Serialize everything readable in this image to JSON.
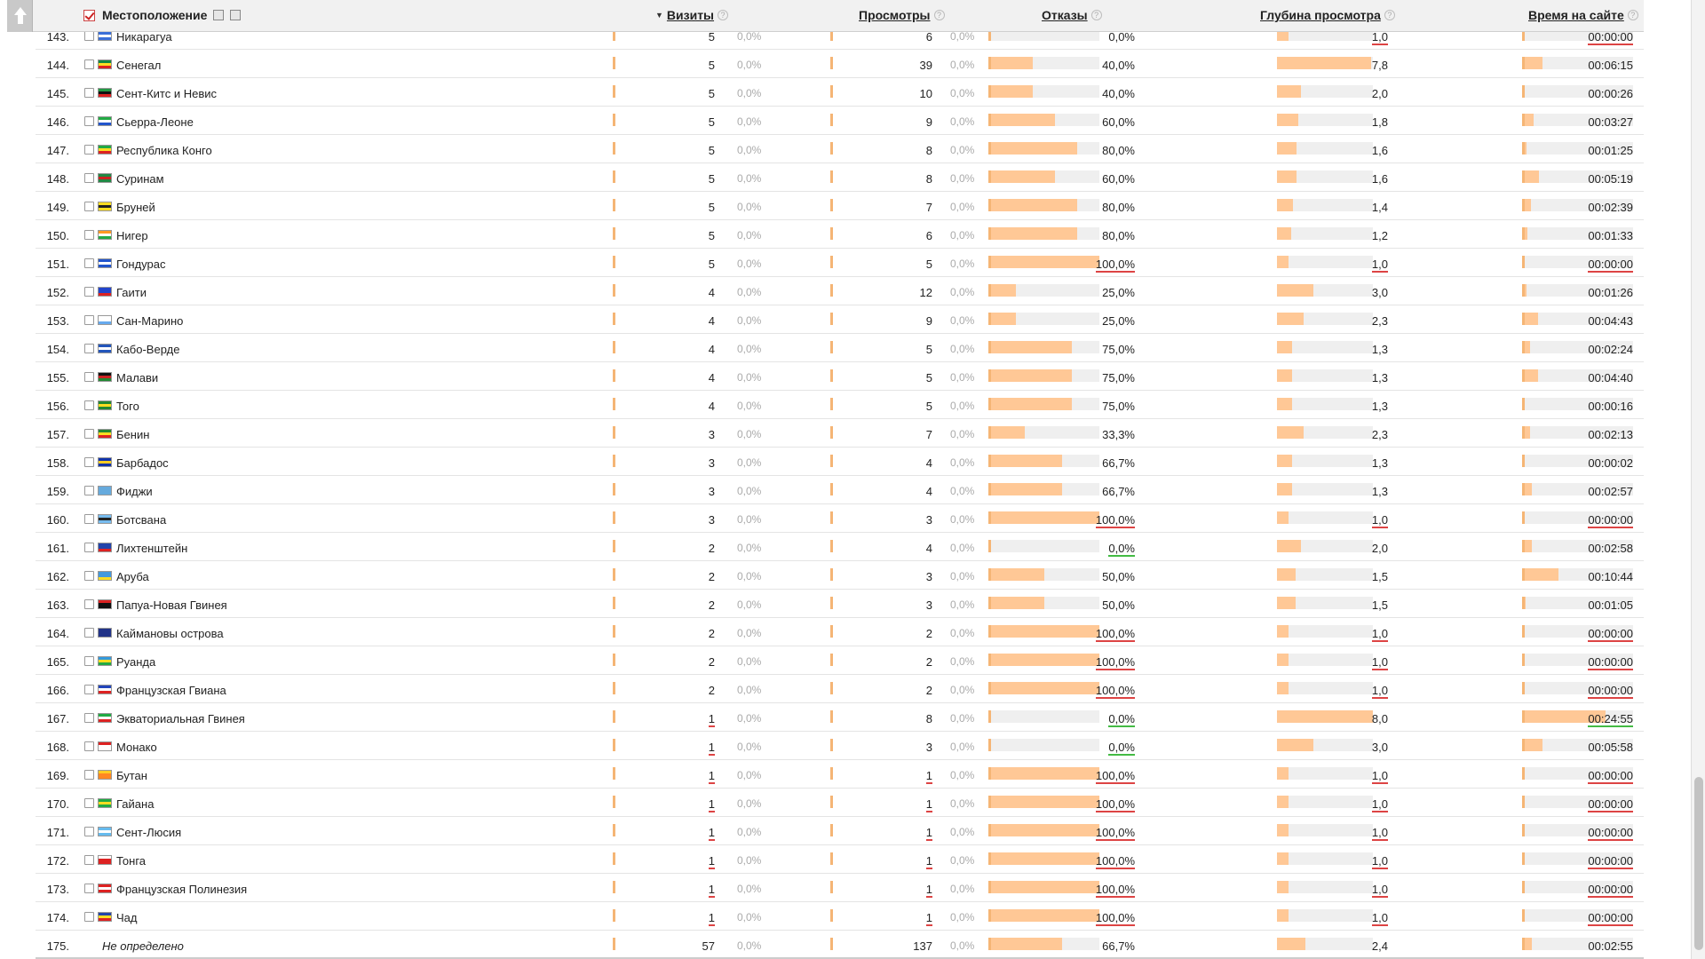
{
  "header": {
    "location_label": "Местоположение",
    "visits_label": "Визиты",
    "views_label": "Просмотры",
    "bounce_label": "Отказы",
    "depth_label": "Глубина просмотра",
    "time_label": "Время на сайте",
    "help_glyph": "?",
    "sort_glyph": "▼"
  },
  "rows": [
    {
      "n": "143.",
      "name": "Никарагуа",
      "visits": "5",
      "vpct": "0,0%",
      "views": "6",
      "wpct": "0,0%",
      "bounce": "0,0%",
      "bounce_frac": 0.0,
      "bounce_mark": "none",
      "depth": "1,0",
      "depth_frac": 0.12,
      "depth_mark": "red",
      "time": "00:00:00",
      "time_frac": 0.0,
      "time_mark": "red",
      "flag": [
        "#3a6fd8",
        "#ffffff",
        "#3a6fd8"
      ]
    },
    {
      "n": "144.",
      "name": "Сенегал",
      "visits": "5",
      "vpct": "0,0%",
      "views": "39",
      "wpct": "0,0%",
      "bounce": "40,0%",
      "bounce_frac": 0.4,
      "bounce_mark": "none",
      "depth": "7,8",
      "depth_frac": 0.98,
      "depth_mark": "none",
      "time": "00:06:15",
      "time_frac": 0.18,
      "time_mark": "none",
      "flag": [
        "#118844",
        "#ffdd22",
        "#dd2222"
      ]
    },
    {
      "n": "145.",
      "name": "Сент-Китс и Невис",
      "visits": "5",
      "vpct": "0,0%",
      "views": "10",
      "wpct": "0,0%",
      "bounce": "40,0%",
      "bounce_frac": 0.4,
      "bounce_mark": "none",
      "depth": "2,0",
      "depth_frac": 0.25,
      "depth_mark": "none",
      "time": "00:00:26",
      "time_frac": 0.02,
      "time_mark": "none",
      "flag": [
        "#229944",
        "#111111",
        "#dd2222"
      ]
    },
    {
      "n": "146.",
      "name": "Сьерра-Леоне",
      "visits": "5",
      "vpct": "0,0%",
      "views": "9",
      "wpct": "0,0%",
      "bounce": "60,0%",
      "bounce_frac": 0.6,
      "bounce_mark": "none",
      "depth": "1,8",
      "depth_frac": 0.22,
      "depth_mark": "none",
      "time": "00:03:27",
      "time_frac": 0.1,
      "time_mark": "none",
      "flag": [
        "#22aa44",
        "#ffffff",
        "#2255cc"
      ]
    },
    {
      "n": "147.",
      "name": "Республика Конго",
      "visits": "5",
      "vpct": "0,0%",
      "views": "8",
      "wpct": "0,0%",
      "bounce": "80,0%",
      "bounce_frac": 0.8,
      "bounce_mark": "none",
      "depth": "1,6",
      "depth_frac": 0.2,
      "depth_mark": "none",
      "time": "00:01:25",
      "time_frac": 0.04,
      "time_mark": "none",
      "flag": [
        "#22aa44",
        "#ffdd22",
        "#dd2222"
      ]
    },
    {
      "n": "148.",
      "name": "Суринам",
      "visits": "5",
      "vpct": "0,0%",
      "views": "8",
      "wpct": "0,0%",
      "bounce": "60,0%",
      "bounce_frac": 0.6,
      "bounce_mark": "none",
      "depth": "1,6",
      "depth_frac": 0.2,
      "depth_mark": "none",
      "time": "00:05:19",
      "time_frac": 0.15,
      "time_mark": "none",
      "flag": [
        "#228844",
        "#cc2222",
        "#228844"
      ]
    },
    {
      "n": "149.",
      "name": "Бруней",
      "visits": "5",
      "vpct": "0,0%",
      "views": "7",
      "wpct": "0,0%",
      "bounce": "80,0%",
      "bounce_frac": 0.8,
      "bounce_mark": "none",
      "depth": "1,4",
      "depth_frac": 0.17,
      "depth_mark": "none",
      "time": "00:02:39",
      "time_frac": 0.08,
      "time_mark": "none",
      "flag": [
        "#ffdd22",
        "#222222",
        "#ffdd22"
      ]
    },
    {
      "n": "150.",
      "name": "Нигер",
      "visits": "5",
      "vpct": "0,0%",
      "views": "6",
      "wpct": "0,0%",
      "bounce": "80,0%",
      "bounce_frac": 0.8,
      "bounce_mark": "none",
      "depth": "1,2",
      "depth_frac": 0.15,
      "depth_mark": "none",
      "time": "00:01:33",
      "time_frac": 0.05,
      "time_mark": "none",
      "flag": [
        "#ff9922",
        "#ffffff",
        "#22aa44"
      ]
    },
    {
      "n": "151.",
      "name": "Гондурас",
      "visits": "5",
      "vpct": "0,0%",
      "views": "5",
      "wpct": "0,0%",
      "bounce": "100,0%",
      "bounce_frac": 1.0,
      "bounce_mark": "red",
      "depth": "1,0",
      "depth_frac": 0.12,
      "depth_mark": "red",
      "time": "00:00:00",
      "time_frac": 0.0,
      "time_mark": "red",
      "flag": [
        "#2255cc",
        "#ffffff",
        "#2255cc"
      ]
    },
    {
      "n": "152.",
      "name": "Гаити",
      "visits": "4",
      "vpct": "0,0%",
      "views": "12",
      "wpct": "0,0%",
      "bounce": "25,0%",
      "bounce_frac": 0.25,
      "bounce_mark": "none",
      "depth": "3,0",
      "depth_frac": 0.38,
      "depth_mark": "none",
      "time": "00:01:26",
      "time_frac": 0.04,
      "time_mark": "none",
      "flag": [
        "#2244cc",
        "#2244cc",
        "#dd2222"
      ]
    },
    {
      "n": "153.",
      "name": "Сан-Марино",
      "visits": "4",
      "vpct": "0,0%",
      "views": "9",
      "wpct": "0,0%",
      "bounce": "25,0%",
      "bounce_frac": 0.25,
      "bounce_mark": "none",
      "depth": "2,3",
      "depth_frac": 0.28,
      "depth_mark": "none",
      "time": "00:04:43",
      "time_frac": 0.14,
      "time_mark": "none",
      "flag": [
        "#ffffff",
        "#ffffff",
        "#66aaee"
      ]
    },
    {
      "n": "154.",
      "name": "Кабо-Верде",
      "visits": "4",
      "vpct": "0,0%",
      "views": "5",
      "wpct": "0,0%",
      "bounce": "75,0%",
      "bounce_frac": 0.75,
      "bounce_mark": "none",
      "depth": "1,3",
      "depth_frac": 0.16,
      "depth_mark": "none",
      "time": "00:02:24",
      "time_frac": 0.07,
      "time_mark": "none",
      "flag": [
        "#2255bb",
        "#ffffff",
        "#2255bb"
      ]
    },
    {
      "n": "155.",
      "name": "Малави",
      "visits": "4",
      "vpct": "0,0%",
      "views": "5",
      "wpct": "0,0%",
      "bounce": "75,0%",
      "bounce_frac": 0.75,
      "bounce_mark": "none",
      "depth": "1,3",
      "depth_frac": 0.16,
      "depth_mark": "none",
      "time": "00:04:40",
      "time_frac": 0.14,
      "time_mark": "none",
      "flag": [
        "#111111",
        "#cc2222",
        "#228833"
      ]
    },
    {
      "n": "156.",
      "name": "Того",
      "visits": "4",
      "vpct": "0,0%",
      "views": "5",
      "wpct": "0,0%",
      "bounce": "75,0%",
      "bounce_frac": 0.75,
      "bounce_mark": "none",
      "depth": "1,3",
      "depth_frac": 0.16,
      "depth_mark": "none",
      "time": "00:00:16",
      "time_frac": 0.01,
      "time_mark": "none",
      "flag": [
        "#228833",
        "#ffdd22",
        "#228833"
      ]
    },
    {
      "n": "157.",
      "name": "Бенин",
      "visits": "3",
      "vpct": "0,0%",
      "views": "7",
      "wpct": "0,0%",
      "bounce": "33,3%",
      "bounce_frac": 0.33,
      "bounce_mark": "none",
      "depth": "2,3",
      "depth_frac": 0.28,
      "depth_mark": "none",
      "time": "00:02:13",
      "time_frac": 0.07,
      "time_mark": "none",
      "flag": [
        "#228833",
        "#ffdd22",
        "#dd2222"
      ]
    },
    {
      "n": "158.",
      "name": "Барбадос",
      "visits": "3",
      "vpct": "0,0%",
      "views": "4",
      "wpct": "0,0%",
      "bounce": "66,7%",
      "bounce_frac": 0.667,
      "bounce_mark": "none",
      "depth": "1,3",
      "depth_frac": 0.16,
      "depth_mark": "none",
      "time": "00:00:02",
      "time_frac": 0.0,
      "time_mark": "none",
      "flag": [
        "#1133aa",
        "#ffcc22",
        "#1133aa"
      ]
    },
    {
      "n": "159.",
      "name": "Фиджи",
      "visits": "3",
      "vpct": "0,0%",
      "views": "4",
      "wpct": "0,0%",
      "bounce": "66,7%",
      "bounce_frac": 0.667,
      "bounce_mark": "none",
      "depth": "1,3",
      "depth_frac": 0.16,
      "depth_mark": "none",
      "time": "00:02:57",
      "time_frac": 0.09,
      "time_mark": "none",
      "flag": [
        "#66aadd",
        "#66aadd",
        "#66aadd"
      ]
    },
    {
      "n": "160.",
      "name": "Ботсвана",
      "visits": "3",
      "vpct": "0,0%",
      "views": "3",
      "wpct": "0,0%",
      "bounce": "100,0%",
      "bounce_frac": 1.0,
      "bounce_mark": "red",
      "depth": "1,0",
      "depth_frac": 0.12,
      "depth_mark": "red",
      "time": "00:00:00",
      "time_frac": 0.0,
      "time_mark": "red",
      "flag": [
        "#77bbee",
        "#222222",
        "#77bbee"
      ]
    },
    {
      "n": "161.",
      "name": "Лихтенштейн",
      "visits": "2",
      "vpct": "0,0%",
      "views": "4",
      "wpct": "0,0%",
      "bounce": "0,0%",
      "bounce_frac": 0.0,
      "bounce_mark": "green",
      "depth": "2,0",
      "depth_frac": 0.25,
      "depth_mark": "none",
      "time": "00:02:58",
      "time_frac": 0.09,
      "time_mark": "none",
      "flag": [
        "#2244aa",
        "#2244aa",
        "#dd2222"
      ]
    },
    {
      "n": "162.",
      "name": "Аруба",
      "visits": "2",
      "vpct": "0,0%",
      "views": "3",
      "wpct": "0,0%",
      "bounce": "50,0%",
      "bounce_frac": 0.5,
      "bounce_mark": "none",
      "depth": "1,5",
      "depth_frac": 0.19,
      "depth_mark": "none",
      "time": "00:10:44",
      "time_frac": 0.33,
      "time_mark": "none",
      "flag": [
        "#4499dd",
        "#4499dd",
        "#ffdd22"
      ]
    },
    {
      "n": "163.",
      "name": "Папуа-Новая Гвинея",
      "visits": "2",
      "vpct": "0,0%",
      "views": "3",
      "wpct": "0,0%",
      "bounce": "50,0%",
      "bounce_frac": 0.5,
      "bounce_mark": "none",
      "depth": "1,5",
      "depth_frac": 0.19,
      "depth_mark": "none",
      "time": "00:01:05",
      "time_frac": 0.03,
      "time_mark": "none",
      "flag": [
        "#dd2222",
        "#111111",
        "#111111"
      ]
    },
    {
      "n": "164.",
      "name": "Каймановы острова",
      "visits": "2",
      "vpct": "0,0%",
      "views": "2",
      "wpct": "0,0%",
      "bounce": "100,0%",
      "bounce_frac": 1.0,
      "bounce_mark": "red",
      "depth": "1,0",
      "depth_frac": 0.12,
      "depth_mark": "red",
      "time": "00:00:00",
      "time_frac": 0.0,
      "time_mark": "red",
      "flag": [
        "#223388",
        "#223388",
        "#223388"
      ]
    },
    {
      "n": "165.",
      "name": "Руанда",
      "visits": "2",
      "vpct": "0,0%",
      "views": "2",
      "wpct": "0,0%",
      "bounce": "100,0%",
      "bounce_frac": 1.0,
      "bounce_mark": "red",
      "depth": "1,0",
      "depth_frac": 0.12,
      "depth_mark": "red",
      "time": "00:00:00",
      "time_frac": 0.0,
      "time_mark": "red",
      "flag": [
        "#3399dd",
        "#ffdd22",
        "#22aa44"
      ]
    },
    {
      "n": "166.",
      "name": "Французская Гвиана",
      "visits": "2",
      "vpct": "0,0%",
      "views": "2",
      "wpct": "0,0%",
      "bounce": "100,0%",
      "bounce_frac": 1.0,
      "bounce_mark": "red",
      "depth": "1,0",
      "depth_frac": 0.12,
      "depth_mark": "red",
      "time": "00:00:00",
      "time_frac": 0.0,
      "time_mark": "red",
      "flag": [
        "#2244bb",
        "#ffffff",
        "#dd2222"
      ]
    },
    {
      "n": "167.",
      "name": "Экваториальная Гвинея",
      "visits": "1",
      "vpct": "0,0%",
      "views": "8",
      "wpct": "0,0%",
      "bounce": "0,0%",
      "bounce_frac": 0.0,
      "bounce_mark": "green",
      "depth": "8,0",
      "depth_frac": 1.0,
      "depth_mark": "none",
      "time": "00:24:55",
      "time_frac": 0.75,
      "time_mark": "green",
      "visits_mark": "red",
      "flag": [
        "#22aa44",
        "#ffffff",
        "#dd2222"
      ]
    },
    {
      "n": "168.",
      "name": "Монако",
      "visits": "1",
      "vpct": "0,0%",
      "views": "3",
      "wpct": "0,0%",
      "bounce": "0,0%",
      "bounce_frac": 0.0,
      "bounce_mark": "green",
      "depth": "3,0",
      "depth_frac": 0.38,
      "depth_mark": "none",
      "time": "00:05:58",
      "time_frac": 0.18,
      "time_mark": "none",
      "visits_mark": "red",
      "flag": [
        "#dd2222",
        "#ffffff",
        "#ffffff"
      ]
    },
    {
      "n": "169.",
      "name": "Бутан",
      "visits": "1",
      "vpct": "0,0%",
      "views": "1",
      "wpct": "0,0%",
      "bounce": "100,0%",
      "bounce_frac": 1.0,
      "bounce_mark": "red",
      "depth": "1,0",
      "depth_frac": 0.12,
      "depth_mark": "red",
      "time": "00:00:00",
      "time_frac": 0.0,
      "time_mark": "red",
      "visits_mark": "red",
      "views_mark": "red",
      "flag": [
        "#ffcc22",
        "#ff8822",
        "#ff8822"
      ]
    },
    {
      "n": "170.",
      "name": "Гайана",
      "visits": "1",
      "vpct": "0,0%",
      "views": "1",
      "wpct": "0,0%",
      "bounce": "100,0%",
      "bounce_frac": 1.0,
      "bounce_mark": "red",
      "depth": "1,0",
      "depth_frac": 0.12,
      "depth_mark": "red",
      "time": "00:00:00",
      "time_frac": 0.0,
      "time_mark": "red",
      "visits_mark": "red",
      "views_mark": "red",
      "flag": [
        "#22aa44",
        "#ffdd22",
        "#22aa44"
      ]
    },
    {
      "n": "171.",
      "name": "Сент-Люсия",
      "visits": "1",
      "vpct": "0,0%",
      "views": "1",
      "wpct": "0,0%",
      "bounce": "100,0%",
      "bounce_frac": 1.0,
      "bounce_mark": "red",
      "depth": "1,0",
      "depth_frac": 0.12,
      "depth_mark": "red",
      "time": "00:00:00",
      "time_frac": 0.0,
      "time_mark": "red",
      "visits_mark": "red",
      "views_mark": "red",
      "flag": [
        "#66bbee",
        "#ffffff",
        "#66bbee"
      ]
    },
    {
      "n": "172.",
      "name": "Тонга",
      "visits": "1",
      "vpct": "0,0%",
      "views": "1",
      "wpct": "0,0%",
      "bounce": "100,0%",
      "bounce_frac": 1.0,
      "bounce_mark": "red",
      "depth": "1,0",
      "depth_frac": 0.12,
      "depth_mark": "red",
      "time": "00:00:00",
      "time_frac": 0.0,
      "time_mark": "red",
      "visits_mark": "red",
      "views_mark": "red",
      "flag": [
        "#ffffff",
        "#dd2222",
        "#dd2222"
      ]
    },
    {
      "n": "173.",
      "name": "Французская Полинезия",
      "visits": "1",
      "vpct": "0,0%",
      "views": "1",
      "wpct": "0,0%",
      "bounce": "100,0%",
      "bounce_frac": 1.0,
      "bounce_mark": "red",
      "depth": "1,0",
      "depth_frac": 0.12,
      "depth_mark": "red",
      "time": "00:00:00",
      "time_frac": 0.0,
      "time_mark": "red",
      "visits_mark": "red",
      "views_mark": "red",
      "flag": [
        "#dd2222",
        "#ffffff",
        "#dd2222"
      ]
    },
    {
      "n": "174.",
      "name": "Чад",
      "visits": "1",
      "vpct": "0,0%",
      "views": "1",
      "wpct": "0,0%",
      "bounce": "100,0%",
      "bounce_frac": 1.0,
      "bounce_mark": "red",
      "depth": "1,0",
      "depth_frac": 0.12,
      "depth_mark": "red",
      "time": "00:00:00",
      "time_frac": 0.0,
      "time_mark": "red",
      "visits_mark": "red",
      "views_mark": "red",
      "flag": [
        "#2244aa",
        "#ffdd22",
        "#dd2222"
      ]
    },
    {
      "n": "175.",
      "name": "Не определено",
      "undefined": true,
      "visits": "57",
      "vpct": "0,0%",
      "views": "137",
      "wpct": "0,0%",
      "bounce": "66,7%",
      "bounce_frac": 0.667,
      "bounce_mark": "none",
      "depth": "2,4",
      "depth_frac": 0.3,
      "depth_mark": "none",
      "time": "00:02:55",
      "time_frac": 0.09,
      "time_mark": "none"
    }
  ],
  "colors": {
    "bar_fill": "#ffc896",
    "bar_bg": "#efefef",
    "mark_red": "#dd4444",
    "mark_green": "#44bb44"
  },
  "icons": {
    "scroll_up": "arrow-up-icon",
    "help": "question-icon",
    "check": "checkbox-icon"
  }
}
